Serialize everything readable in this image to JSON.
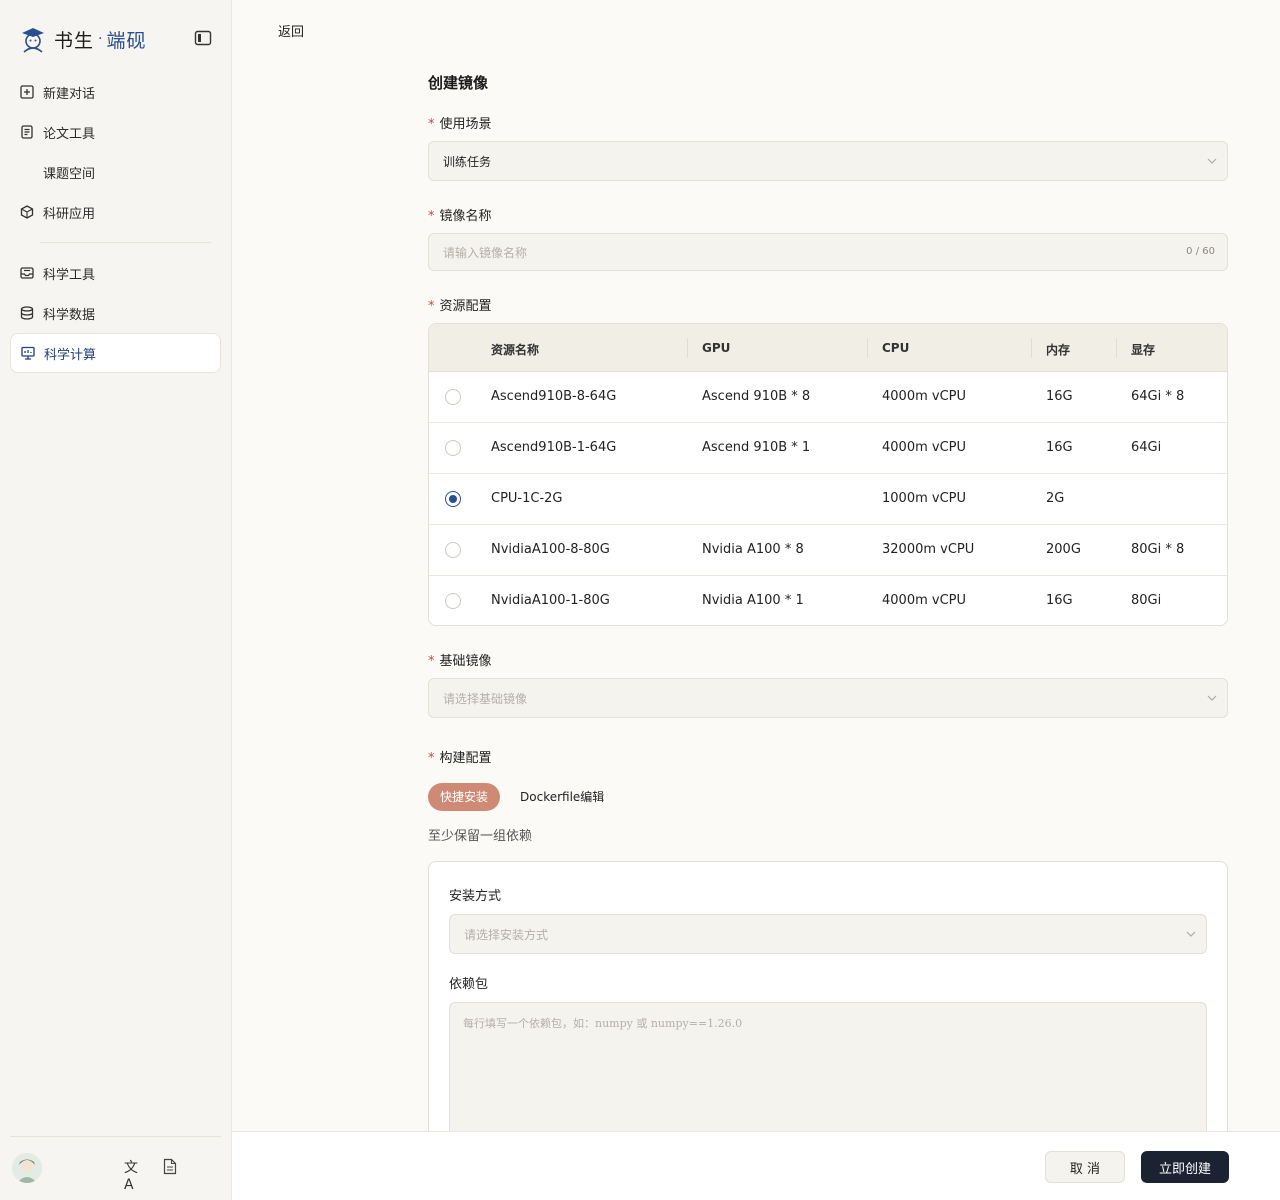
{
  "brand": {
    "name": "书生",
    "dot": "·",
    "sub": "端砚",
    "accent": "#2a4f8f"
  },
  "sidebar": {
    "items": [
      {
        "label": "新建对话",
        "icon": "plus-square-icon"
      },
      {
        "label": "论文工具",
        "icon": "document-icon"
      },
      {
        "label": "课题空间",
        "icon": ""
      },
      {
        "label": "科研应用",
        "icon": "cube-icon"
      },
      {
        "label": "科学工具",
        "icon": "inbox-icon"
      },
      {
        "label": "科学数据",
        "icon": "database-icon"
      },
      {
        "label": "科学计算",
        "icon": "monitor-icon",
        "active": true
      }
    ],
    "lang_label": "文A"
  },
  "main": {
    "back_label": "返回",
    "title": "创建镜像",
    "scene": {
      "label": "使用场景",
      "value": "训练任务"
    },
    "image_name": {
      "label": "镜像名称",
      "placeholder": "请输入镜像名称",
      "count": "0 / 60"
    },
    "resources": {
      "label": "资源配置",
      "columns": [
        "资源名称",
        "GPU",
        "CPU",
        "内存",
        "显存"
      ],
      "rows": [
        {
          "name": "Ascend910B-8-64G",
          "gpu": "Ascend 910B * 8",
          "cpu": "4000m vCPU",
          "mem": "16G",
          "vram": "64Gi * 8",
          "selected": false
        },
        {
          "name": "Ascend910B-1-64G",
          "gpu": "Ascend 910B * 1",
          "cpu": "4000m vCPU",
          "mem": "16G",
          "vram": "64Gi",
          "selected": false
        },
        {
          "name": "CPU-1C-2G",
          "gpu": "",
          "cpu": "1000m vCPU",
          "mem": "2G",
          "vram": "",
          "selected": true
        },
        {
          "name": "NvidiaA100-8-80G",
          "gpu": "Nvidia A100 * 8",
          "cpu": "32000m vCPU",
          "mem": "200G",
          "vram": "80Gi * 8",
          "selected": false
        },
        {
          "name": "NvidiaA100-1-80G",
          "gpu": "Nvidia A100 * 1",
          "cpu": "4000m vCPU",
          "mem": "16G",
          "vram": "80Gi",
          "selected": false
        }
      ]
    },
    "base_image": {
      "label": "基础镜像",
      "placeholder": "请选择基础镜像"
    },
    "build": {
      "label": "构建配置",
      "tabs": [
        "快捷安装",
        "Dockerfile编辑"
      ],
      "active_tab_color": "#cf8a76",
      "hint": "至少保留一组依赖",
      "install_method": {
        "label": "安装方式",
        "placeholder": "请选择安装方式"
      },
      "packages": {
        "label": "依赖包",
        "placeholder": "每行填写一个依赖包，如：numpy 或 numpy==1.26.0"
      }
    }
  },
  "footer": {
    "cancel": "取 消",
    "create": "立即创建"
  }
}
